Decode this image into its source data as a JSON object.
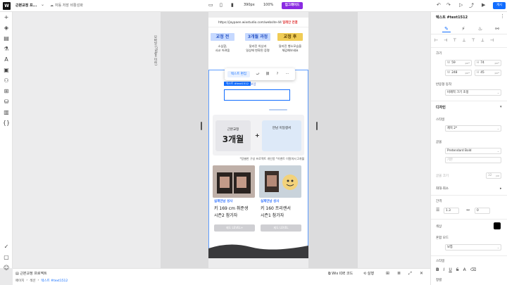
{
  "topbar": {
    "site_name": "근본교정 프...",
    "save_status": "자동 저장 비활성화",
    "width_label": "390px",
    "zoom_label": "100%",
    "upgrade_label": "업그레이드",
    "publish_label": "게시"
  },
  "canvas": {
    "vertical_label": "모바일 (750px 이하)",
    "url_prefix": "https://jaypaen.wixstudio.com/website-44",
    "url_link": "일레안 연결",
    "stages": [
      {
        "label": "교정 전",
        "desc": "소심함,\n사교 어려움",
        "bg": "#c6d9ff",
        "color": "#2b56c6"
      },
      {
        "label": "3개월 과정",
        "desc": "달라진 의상과\n일상에 변화된 증명",
        "bg": "#c6d9ff",
        "color": "#2b56c6"
      },
      {
        "label": "교정 후",
        "desc": "달라진 행소모습을\n체감해보세요",
        "bg": "#f0cc55",
        "color": "#5a3e00"
      }
    ],
    "floating_toolbar": {
      "edit_label": "텍스트 편집",
      "more_label": "···"
    },
    "text_hint": "텍스트 추가 행정제 보상",
    "selection_tag": "텍스트 #text1512",
    "price_card": {
      "small": "근본교정",
      "big": "3개월"
    },
    "plus": "+",
    "free_card": {
      "label": "만남 이일생서"
    },
    "footnote": "*팀별한 구성 프로젝트 개인몽 *이벤트 이탈여서 2개월",
    "persons": [
      {
        "tag": "실제만남 성사",
        "line1": "키 169 cm 취준생",
        "line2": "시즌2 참가자",
        "button": "제도 LEVEL+"
      },
      {
        "tag": "실제만남 성사",
        "line1": "키 160 프리랜서",
        "line2": "시즌1 참가자",
        "button": "제도 LEVEL"
      }
    ]
  },
  "right_panel": {
    "title": "텍스트 #text1512",
    "size_label": "크기",
    "w_value": "59",
    "h_value": "74",
    "min_w": "248",
    "min_h": "45",
    "unit_px": "px*",
    "responsive_label": "반응형 동작",
    "responsive_value": "비례적 크기 조정",
    "design_label": "디자인",
    "style_label": "스타일",
    "style_value": "제목 2*",
    "font_label": "글꼴",
    "font_value": "Pretendard Bold",
    "weight_value": "기본",
    "size_field_label": "글꼴 크기",
    "size_value": "32",
    "max_min_label": "최대·최소",
    "spacing_label": "간격",
    "line_height": "1.3",
    "letter_spacing": "0",
    "color_label": "색상",
    "blend_label": "혼합 모드",
    "blend_value": "보통",
    "style2_label": "스타일",
    "style_icons": [
      "B",
      "I",
      "U",
      "S",
      "A",
      "⌫"
    ],
    "last_label": "정렬"
  },
  "bottombar": {
    "project_label": "근본교정 프로젝트",
    "breadcrumb": [
      "페이지",
      "섹션",
      "텍스트 #text1512"
    ],
    "ide_label": "Wix IDE 코드",
    "run_label": "실행"
  },
  "colors": {
    "accent": "#116dff",
    "upgrade": "#8a2be2",
    "selection": "#5b9bff"
  }
}
